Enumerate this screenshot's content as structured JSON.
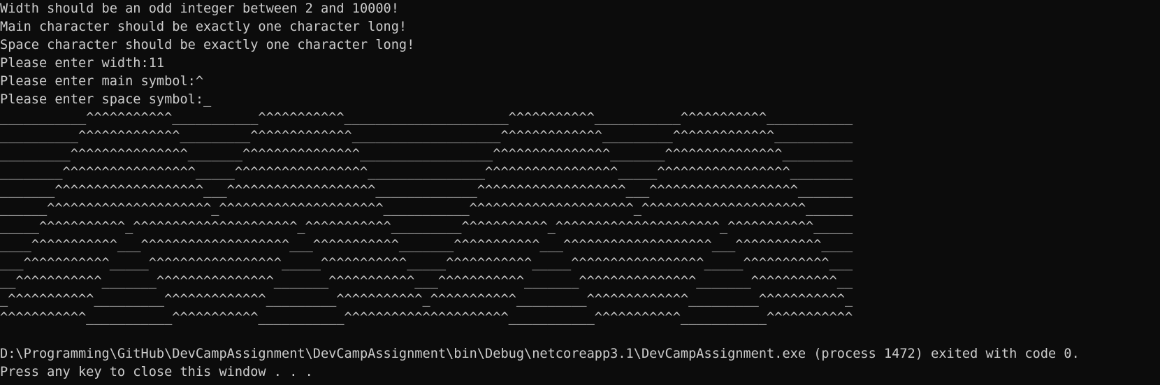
{
  "console": {
    "messages": [
      "Width should be an odd integer between 2 and 10000!",
      "Main character should be exactly one character long!",
      "Space character should be exactly one character long!",
      "Please enter width:11",
      "Please enter main symbol:^",
      "Please enter space symbol:_"
    ],
    "pattern": [
      "___________^^^^^^^^^^^___________^^^^^^^^^^^_____________________^^^^^^^^^^^___________^^^^^^^^^^^___________",
      "__________^^^^^^^^^^^^^_________^^^^^^^^^^^^^___________________^^^^^^^^^^^^^_________^^^^^^^^^^^^^__________",
      "_________^^^^^^^^^^^^^^^_______^^^^^^^^^^^^^^^_________________^^^^^^^^^^^^^^^_______^^^^^^^^^^^^^^^_________",
      "________^^^^^^^^^^^^^^^^^_____^^^^^^^^^^^^^^^^^_______________^^^^^^^^^^^^^^^^^_____^^^^^^^^^^^^^^^^^________",
      "_______^^^^^^^^^^^^^^^^^^^___^^^^^^^^^^^^^^^^^^^_____________^^^^^^^^^^^^^^^^^^^___^^^^^^^^^^^^^^^^^^^_______",
      "______^^^^^^^^^^^^^^^^^^^^^_^^^^^^^^^^^^^^^^^^^^^___________^^^^^^^^^^^^^^^^^^^^^_^^^^^^^^^^^^^^^^^^^^^______",
      "_____^^^^^^^^^^^_^^^^^^^^^^^^^^^^^^^^^_^^^^^^^^^^^_________^^^^^^^^^^^_^^^^^^^^^^^^^^^^^^^^^_^^^^^^^^^^^_____",
      "____^^^^^^^^^^^___^^^^^^^^^^^^^^^^^^^___^^^^^^^^^^^_______^^^^^^^^^^^___^^^^^^^^^^^^^^^^^^^___^^^^^^^^^^^____",
      "___^^^^^^^^^^^_____^^^^^^^^^^^^^^^^^_____^^^^^^^^^^^_____^^^^^^^^^^^_____^^^^^^^^^^^^^^^^^_____^^^^^^^^^^^___",
      "__^^^^^^^^^^^_______^^^^^^^^^^^^^^^_______^^^^^^^^^^^___^^^^^^^^^^^_______^^^^^^^^^^^^^^^_______^^^^^^^^^^^__",
      "_^^^^^^^^^^^_________^^^^^^^^^^^^^_________^^^^^^^^^^^_^^^^^^^^^^^_________^^^^^^^^^^^^^_________^^^^^^^^^^^_",
      "^^^^^^^^^^^___________^^^^^^^^^^^___________^^^^^^^^^^^^^^^^^^^^^___________^^^^^^^^^^^___________^^^^^^^^^^^"
    ],
    "exit_message": "D:\\Programming\\GitHub\\DevCampAssignment\\DevCampAssignment\\bin\\Debug\\netcoreapp3.1\\DevCampAssignment.exe (process 1472) exited with code 0.",
    "prompt_message": "Press any key to close this window . . ."
  },
  "colors": {
    "background": "#0c0c0c",
    "foreground": "#cccccc"
  }
}
